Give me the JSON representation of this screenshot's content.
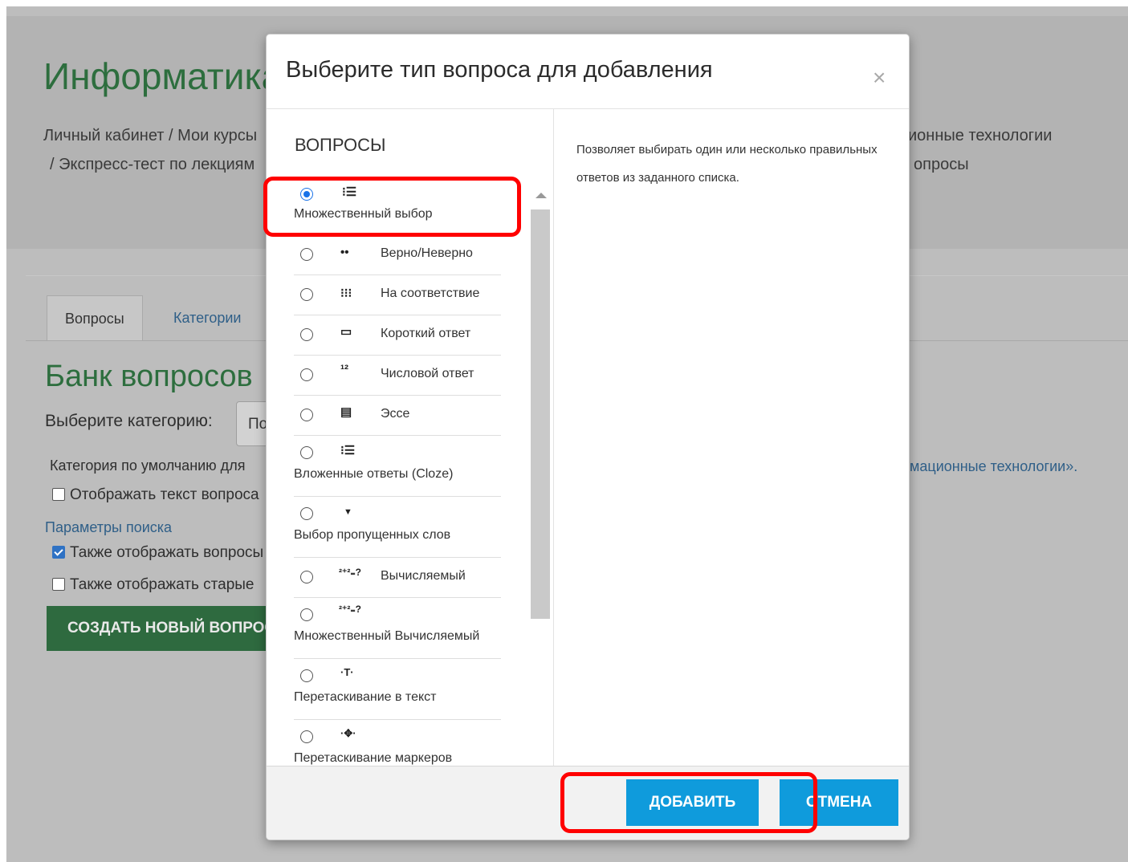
{
  "page": {
    "course_title": "Информатика",
    "breadcrumb_line1_left": "Личный кабинет / Мои курсы",
    "breadcrumb_line1_right": "ионные технологии",
    "breadcrumb_line2_left": "/ Экспресс-тест по лекциям",
    "breadcrumb_line2_right": "опросы",
    "tabs": [
      "Вопросы",
      "Категории"
    ],
    "bank_title": "Банк вопросов",
    "select_category_label": "Выберите категорию:",
    "select_category_value": "По",
    "default_category_text_left": "Категория по умолчанию для",
    "default_category_text_right": "мационные технологии».",
    "show_question_text": "Отображать текст вопроса",
    "search_params_link": "Параметры поиска",
    "also_show_subcats": "Также отображать вопросы",
    "also_show_old": "Также отображать старые",
    "create_new_button": "СОЗДАТЬ НОВЫЙ ВОПРОС"
  },
  "modal": {
    "title": "Выберите тип вопроса для добавления",
    "close_symbol": "×",
    "section_heading": "ВОПРОСЫ",
    "description": "Позволяет выбирать один или несколько правильных ответов из заданного списка.",
    "question_types": [
      {
        "label": "Множественный выбор",
        "icon": "multiple-choice-icon",
        "glyph": "⁝☰",
        "selected": true
      },
      {
        "label": "Верно/Неверно",
        "icon": "true-false-icon",
        "glyph": "••",
        "selected": false
      },
      {
        "label": "На соответствие",
        "icon": "matching-icon",
        "glyph": "⁝⁝⁝",
        "selected": false
      },
      {
        "label": "Короткий ответ",
        "icon": "short-answer-icon",
        "glyph": "▭",
        "selected": false
      },
      {
        "label": "Числовой ответ",
        "icon": "numerical-icon",
        "glyph": "¹²",
        "selected": false
      },
      {
        "label": "Эссе",
        "icon": "essay-icon",
        "glyph": "▤",
        "selected": false
      },
      {
        "label": "Вложенные ответы (Cloze)",
        "icon": "cloze-icon",
        "glyph": "⁝☰",
        "selected": false
      },
      {
        "label": "Выбор пропущенных слов",
        "icon": "gapselect-icon",
        "glyph": "▼",
        "selected": false
      },
      {
        "label": "Вычисляемый",
        "icon": "calculated-icon",
        "glyph": "²⁺²₌?",
        "selected": false
      },
      {
        "label": "Множественный Вычисляемый",
        "icon": "calculated-multi-icon",
        "glyph": "²⁺²₌?",
        "selected": false
      },
      {
        "label": "Перетаскивание в текст",
        "icon": "drag-to-text-icon",
        "glyph": "·T·",
        "selected": false
      },
      {
        "label": "Перетаскивание маркеров",
        "icon": "drag-markers-icon",
        "glyph": "·✥·",
        "selected": false
      }
    ],
    "add_button": "ДОБАВИТЬ",
    "cancel_button": "ОТМЕНА"
  },
  "colors": {
    "accent_green": "#2d6e3e",
    "button_blue": "#0f9bdc",
    "highlight_red": "#ff0000"
  }
}
